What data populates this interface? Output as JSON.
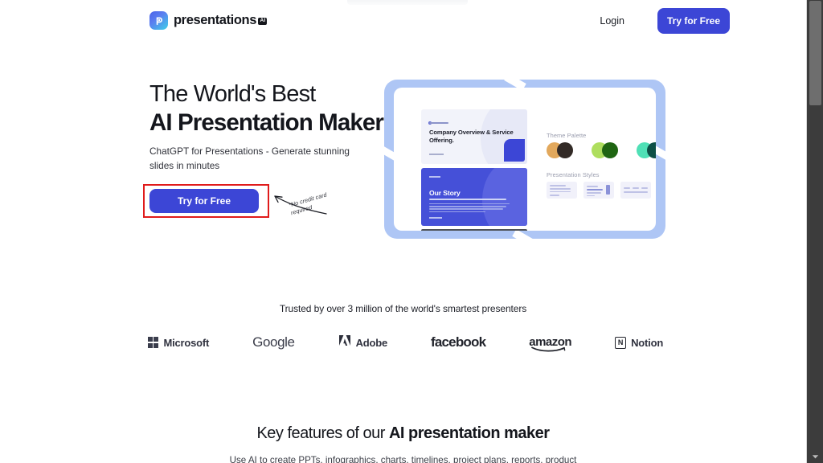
{
  "header": {
    "logo_text": "presentations",
    "logo_badge": "AI",
    "logo_icon": "p-gradient-logo-icon",
    "login_label": "Login",
    "cta_label": "Try for Free"
  },
  "hero": {
    "title_line1": "The World's Best",
    "title_line2": "AI Presentation Maker",
    "subtitle": "ChatGPT for Presentations - Generate stunning slides in minutes",
    "cta_label": "Try for Free",
    "annotation_note": "*No credit card required",
    "highlight_color": "#e01b1b",
    "accent_color": "#3c46d6",
    "preview": {
      "slide1_title": "Company Overview & Service Offering.",
      "slide2_title": "Our Story",
      "theme_palette_label": "Theme Palette",
      "presentation_styles_label": "Presentation Styles",
      "palette": [
        {
          "light": "#e3a martingale",
          "c1": "#e2a85c",
          "c2": "#322a26"
        },
        {
          "c1": "#aede5e",
          "c2": "#1f6512"
        },
        {
          "c1": "#4fe0b6",
          "c2": "#0c4f46"
        }
      ]
    }
  },
  "trusted": {
    "headline": "Trusted by over 3 million of the world's smartest presenters",
    "brands": [
      {
        "name": "Microsoft",
        "icon": "microsoft-grid-icon"
      },
      {
        "name": "Google",
        "icon": "google-wordmark-icon"
      },
      {
        "name": "Adobe",
        "icon": "adobe-a-icon"
      },
      {
        "name": "facebook",
        "icon": "facebook-wordmark-icon"
      },
      {
        "name": "amazon",
        "icon": "amazon-wordmark-icon"
      },
      {
        "name": "Notion",
        "icon": "notion-n-icon"
      }
    ]
  },
  "key_features": {
    "title_plain": "Key features of our ",
    "title_strong": "AI presentation maker",
    "subtitle": "Use AI to create PPTs, infographics, charts, timelines, project plans, reports, product"
  },
  "scrollbar": {
    "track_color": "#3c3c3c",
    "thumb_color": "#6e6e6e"
  }
}
